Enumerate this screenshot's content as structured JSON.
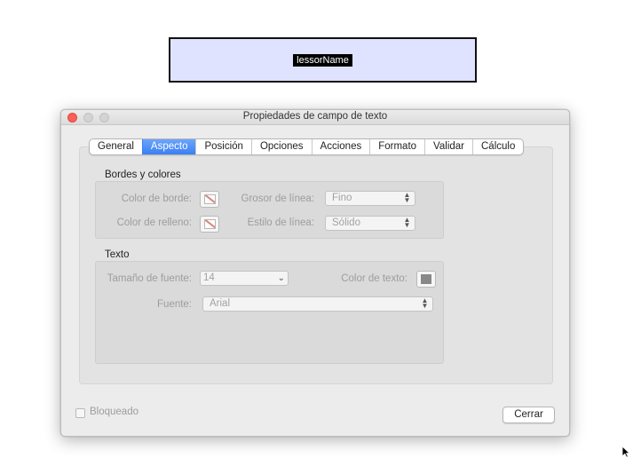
{
  "form_field": {
    "name": "lessorName"
  },
  "dialog": {
    "title": "Propiedades de campo de texto",
    "tabs": [
      "General",
      "Aspecto",
      "Posición",
      "Opciones",
      "Acciones",
      "Formato",
      "Validar",
      "Cálculo"
    ],
    "active_tab": "Aspecto",
    "borders_section": {
      "title": "Bordes y colores",
      "border_color_label": "Color de borde:",
      "fill_color_label": "Color de relleno:",
      "line_width_label": "Grosor de línea:",
      "line_width_value": "Fino",
      "line_style_label": "Estilo de línea:",
      "line_style_value": "Sólido"
    },
    "text_section": {
      "title": "Texto",
      "font_size_label": "Tamaño de fuente:",
      "font_size_value": "14",
      "text_color_label": "Color de texto:",
      "font_label": "Fuente:",
      "font_value": "Arial"
    },
    "locked_label": "Bloqueado",
    "locked_checked": false,
    "close_label": "Cerrar"
  },
  "colors": {
    "accent": "#3b7ff4",
    "field_background": "#dfe3ff",
    "close_light": "#fc5f57",
    "text_color_swatch": "#888888"
  }
}
